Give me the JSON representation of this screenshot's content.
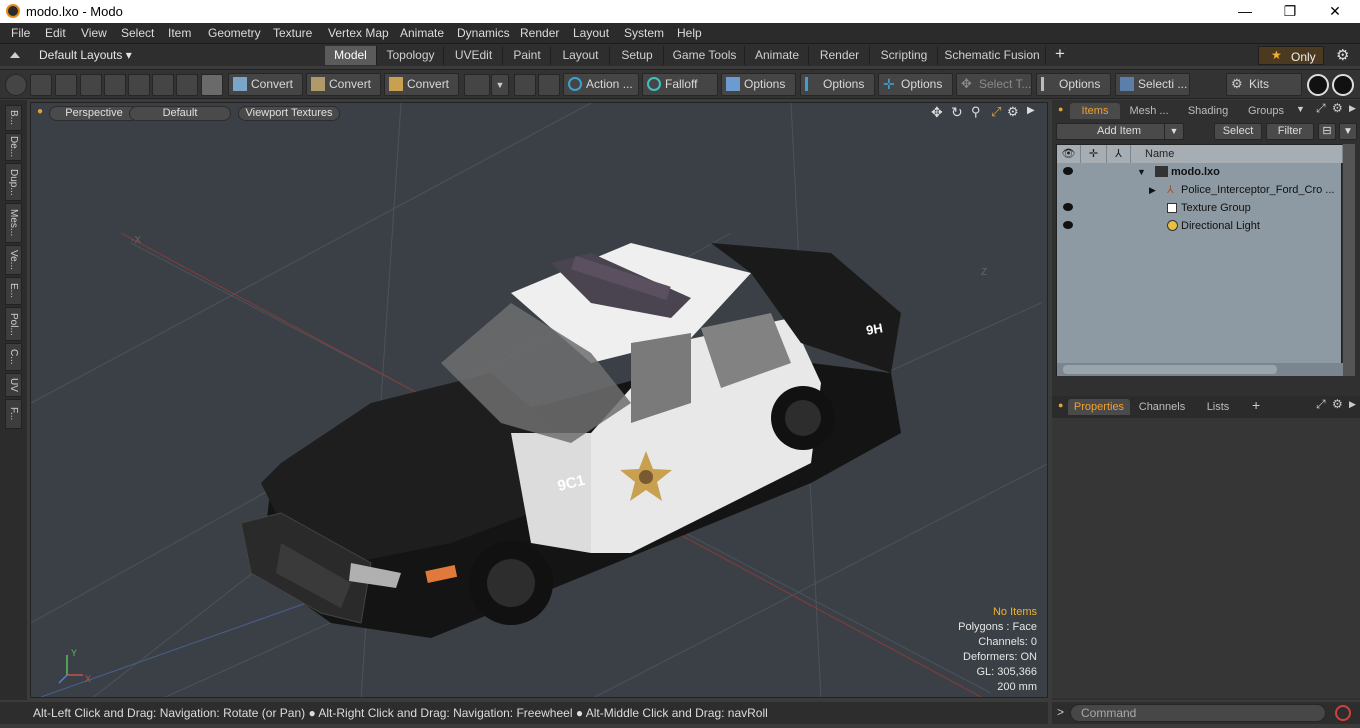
{
  "window": {
    "title": "modo.lxo - Modo",
    "minimize": "—",
    "maximize": "❐",
    "close": "✕"
  },
  "menu": [
    "File",
    "Edit",
    "View",
    "Select",
    "Item",
    "Geometry",
    "Texture",
    "Vertex Map",
    "Animate",
    "Dynamics",
    "Render",
    "Layout",
    "System",
    "Help"
  ],
  "layout_selector": "Default Layouts ▾",
  "layout_tabs": [
    "Model",
    "Topology",
    "UVEdit",
    "Paint",
    "Layout",
    "Setup",
    "Game Tools",
    "Animate",
    "Render",
    "Scripting",
    "Schematic Fusion"
  ],
  "only_label": "Only",
  "toolbar": {
    "convert1": "Convert",
    "convert2": "Convert",
    "convert3": "Convert",
    "action": "Action",
    "falloff": "Falloff",
    "options1": "Options",
    "options2": "Options",
    "options3": "Options",
    "select_t": "Select T...",
    "options4": "Options",
    "selecti": "Selecti ...",
    "kits": "Kits"
  },
  "left_tabs": [
    "B...",
    "De...",
    "Dup...",
    "Mes...",
    "Ve...",
    "E...",
    "Pol...",
    "C...",
    "UV",
    "F..."
  ],
  "viewport": {
    "perspective": "Perspective",
    "shading": "Default",
    "textures": "Viewport Textures",
    "no_items": "No Items",
    "polygons": "Polygons : Face",
    "channels": "Channels: 0",
    "deformers": "Deformers: ON",
    "gl": "GL: 305,366",
    "scale": "200 mm",
    "car_number": "9C1",
    "trunk_number": "9H"
  },
  "items_panel": {
    "tabs": [
      "Items",
      "Mesh ...",
      "Shading",
      "Groups"
    ],
    "add_item": "Add Item",
    "select": "Select",
    "filter": "Filter",
    "name_header": "Name",
    "rows": [
      {
        "name": "modo.lxo",
        "eye": true
      },
      {
        "name": "Police_Interceptor_Ford_Cro ...",
        "eye": false
      },
      {
        "name": "Texture Group",
        "eye": true
      },
      {
        "name": "Directional Light",
        "eye": true
      }
    ]
  },
  "props_panel": {
    "tabs": [
      "Properties",
      "Channels",
      "Lists"
    ]
  },
  "status": "Alt-Left Click and Drag: Navigation: Rotate (or Pan) ● Alt-Right Click and Drag: Navigation: Freewheel ● Alt-Middle Click and Drag: navRoll",
  "command_placeholder": "Command",
  "colors": {
    "accent": "#f0a030",
    "viewport_bg": "#3a4046"
  }
}
